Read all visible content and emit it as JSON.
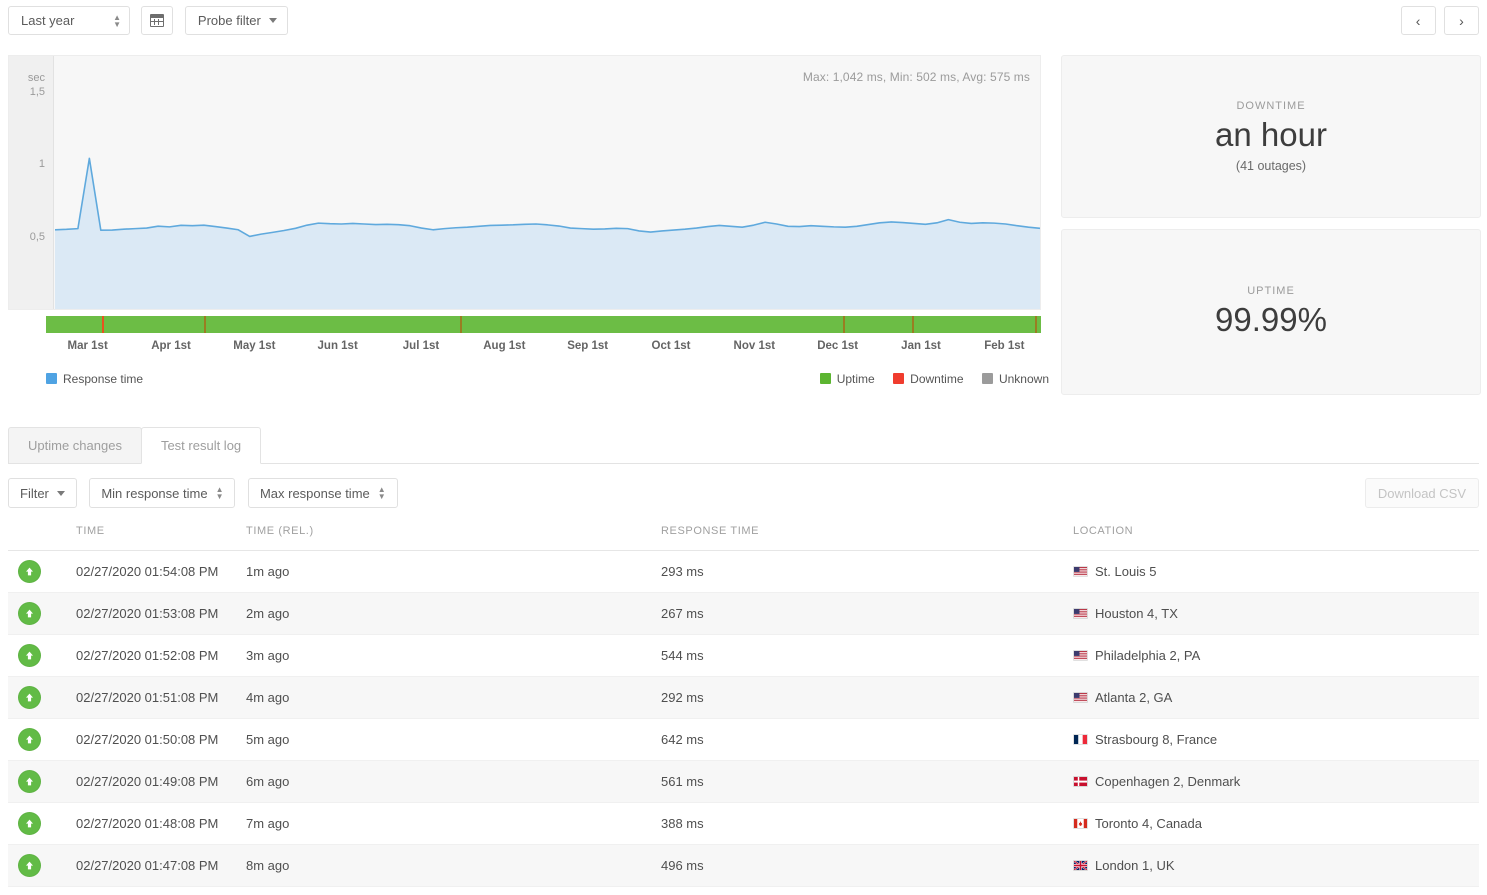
{
  "toolbar": {
    "range_label": "Last year",
    "calendar_icon": "calendar-icon",
    "probe_filter_label": "Probe filter",
    "prev_label": "‹",
    "next_label": "›"
  },
  "chart_data": {
    "type": "area",
    "title": "",
    "stats_text": "Max: 1,042 ms, Min: 502 ms, Avg: 575 ms",
    "max_ms": 1042,
    "min_ms": 502,
    "avg_ms": 575,
    "ylabel": "sec",
    "ytick_labels": [
      "1,5",
      "1",
      "0,5"
    ],
    "ytick_values": [
      1.5,
      1.0,
      0.5
    ],
    "ylim": [
      0,
      1.75
    ],
    "xlabel": "",
    "categories": [
      "Mar 1st",
      "Apr 1st",
      "May 1st",
      "Jun 1st",
      "Jul 1st",
      "Aug 1st",
      "Sep 1st",
      "Oct 1st",
      "Nov 1st",
      "Dec 1st",
      "Jan 1st",
      "Feb 1st"
    ],
    "series": [
      {
        "name": "Response time",
        "color": "#5fa9dd",
        "fill": "#dbe9f5",
        "values": [
          0.548,
          0.551,
          0.556,
          1.042,
          0.545,
          0.546,
          0.552,
          0.556,
          0.56,
          0.573,
          0.568,
          0.579,
          0.576,
          0.58,
          0.57,
          0.56,
          0.548,
          0.502,
          0.518,
          0.53,
          0.543,
          0.558,
          0.58,
          0.594,
          0.59,
          0.588,
          0.592,
          0.588,
          0.584,
          0.586,
          0.583,
          0.576,
          0.56,
          0.548,
          0.556,
          0.562,
          0.566,
          0.572,
          0.578,
          0.58,
          0.582,
          0.586,
          0.588,
          0.582,
          0.574,
          0.56,
          0.556,
          0.552,
          0.554,
          0.558,
          0.556,
          0.54,
          0.532,
          0.54,
          0.546,
          0.552,
          0.56,
          0.57,
          0.578,
          0.572,
          0.566,
          0.58,
          0.6,
          0.588,
          0.572,
          0.57,
          0.576,
          0.572,
          0.568,
          0.566,
          0.572,
          0.584,
          0.596,
          0.602,
          0.598,
          0.592,
          0.586,
          0.596,
          0.618,
          0.6,
          0.592,
          0.596,
          0.594,
          0.588,
          0.576,
          0.566,
          0.558
        ]
      }
    ],
    "legend": [
      {
        "label": "Response time",
        "color": "#5fa9dd"
      }
    ],
    "uptime_bar": {
      "base_color": "#6cbd45",
      "legend": [
        {
          "label": "Uptime",
          "color": "#5cb531"
        },
        {
          "label": "Downtime",
          "color": "#f03c2e"
        },
        {
          "label": "Unknown",
          "color": "#9b9b9b"
        }
      ],
      "outages": [
        {
          "position_pct": 5.6,
          "color": "#e8521f"
        },
        {
          "position_pct": 15.9,
          "color": "#9a7d22"
        },
        {
          "position_pct": 41.6,
          "color": "#9a7d22"
        },
        {
          "position_pct": 80.1,
          "color": "#9a7d22"
        },
        {
          "position_pct": 87.0,
          "color": "#9a7d22"
        },
        {
          "position_pct": 99.4,
          "color": "#9a7d22"
        }
      ]
    }
  },
  "cards": [
    {
      "id": "downtime",
      "label": "Downtime",
      "value": "an hour",
      "sub": "(41 outages)"
    },
    {
      "id": "uptime",
      "label": "Uptime",
      "value": "99.99%",
      "sub": ""
    }
  ],
  "tabs": [
    {
      "id": "uptime-changes",
      "label": "Uptime changes",
      "active": false
    },
    {
      "id": "test-result-log",
      "label": "Test result log",
      "active": true
    }
  ],
  "filters": {
    "filter_label": "Filter",
    "min_response_label": "Min response time",
    "max_response_label": "Max response time",
    "download_label": "Download CSV"
  },
  "table": {
    "columns": [
      "",
      "Time",
      "Time (rel.)",
      "Response time",
      "Location"
    ],
    "rows": [
      {
        "status": "up",
        "time": "02/27/2020 01:54:08 PM",
        "rel": "1m ago",
        "response": "293 ms",
        "location": "St. Louis 5",
        "flag": "us"
      },
      {
        "status": "up",
        "time": "02/27/2020 01:53:08 PM",
        "rel": "2m ago",
        "response": "267 ms",
        "location": "Houston 4, TX",
        "flag": "us"
      },
      {
        "status": "up",
        "time": "02/27/2020 01:52:08 PM",
        "rel": "3m ago",
        "response": "544 ms",
        "location": "Philadelphia 2, PA",
        "flag": "us"
      },
      {
        "status": "up",
        "time": "02/27/2020 01:51:08 PM",
        "rel": "4m ago",
        "response": "292 ms",
        "location": "Atlanta 2, GA",
        "flag": "us"
      },
      {
        "status": "up",
        "time": "02/27/2020 01:50:08 PM",
        "rel": "5m ago",
        "response": "642 ms",
        "location": "Strasbourg 8, France",
        "flag": "fr"
      },
      {
        "status": "up",
        "time": "02/27/2020 01:49:08 PM",
        "rel": "6m ago",
        "response": "561 ms",
        "location": "Copenhagen 2, Denmark",
        "flag": "dk"
      },
      {
        "status": "up",
        "time": "02/27/2020 01:48:08 PM",
        "rel": "7m ago",
        "response": "388 ms",
        "location": "Toronto 4, Canada",
        "flag": "ca"
      },
      {
        "status": "up",
        "time": "02/27/2020 01:47:08 PM",
        "rel": "8m ago",
        "response": "496 ms",
        "location": "London 1, UK",
        "flag": "gb"
      }
    ]
  }
}
